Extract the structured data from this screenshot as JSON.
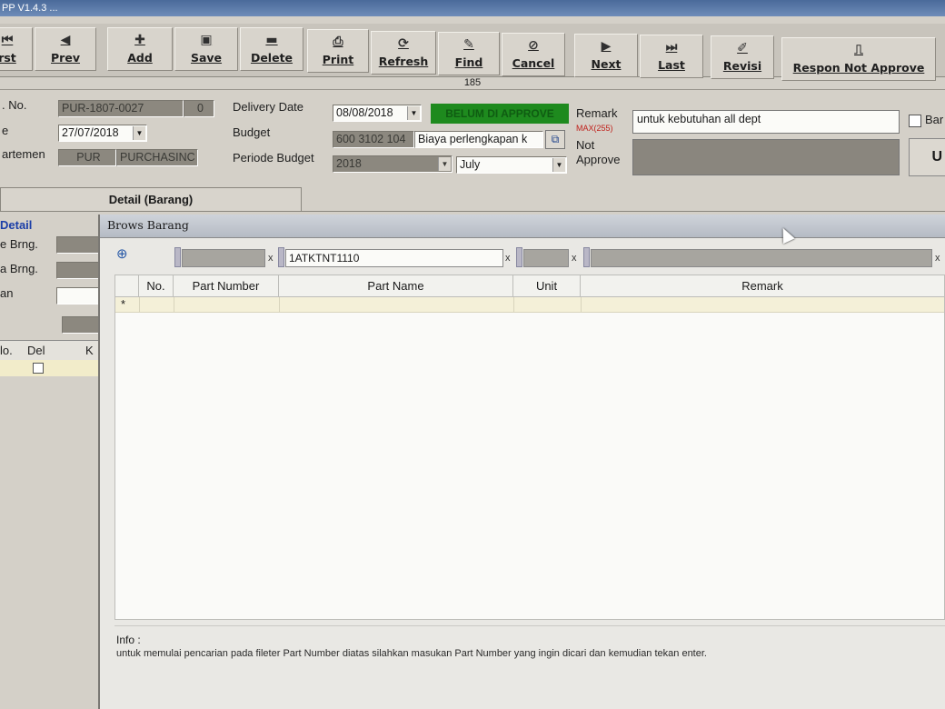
{
  "window": {
    "title": "PP V1.4.3 ..."
  },
  "toolbar": {
    "buttons": [
      {
        "label": "rst",
        "icon": "first-icon"
      },
      {
        "label": "Prev",
        "icon": "prev-icon"
      },
      {
        "label": "Add",
        "icon": "add-icon"
      },
      {
        "label": "Save",
        "icon": "save-icon"
      },
      {
        "label": "Delete",
        "icon": "delete-icon"
      },
      {
        "label": "Print",
        "icon": "print-icon"
      },
      {
        "label": "Refresh",
        "icon": "refresh-icon"
      },
      {
        "label": "Find",
        "icon": "find-icon"
      },
      {
        "label": "Cancel",
        "icon": "cancel-icon"
      },
      {
        "label": "Next",
        "icon": "next-icon"
      },
      {
        "label": "Last",
        "icon": "last-icon"
      },
      {
        "label": "Revisi",
        "icon": "revisi-icon"
      },
      {
        "label": "Respon Not Approve",
        "icon": "respon-icon"
      }
    ]
  },
  "record": {
    "counter": "185"
  },
  "form": {
    "no_label": ". No.",
    "no_value": "PUR-1807-0027",
    "no_rev": "0",
    "date_label": "e",
    "date_value": "27/07/2018",
    "dept_label": "artemen",
    "dept_code": "PUR",
    "dept_name": "PURCHASINC",
    "delivery_label": "Delivery Date",
    "delivery_value": "08/08/2018",
    "budget_label": "Budget",
    "budget_code": "600 3102 104",
    "budget_name": "Biaya perlengkapan k",
    "periode_label": "Periode Budget",
    "periode_year": "2018",
    "periode_month": "July",
    "status": "BELUM DI APPROVE",
    "remark_label": "Remark",
    "remark_max": "MAX(255)",
    "remark_value": "untuk kebutuhan all dept",
    "not_approve_label": "Not Approve",
    "bar_label": "Bar",
    "u_label": "U"
  },
  "tabs": {
    "detail": "Detail (Barang)"
  },
  "left_panel": {
    "detail_label": "Detail",
    "kode_label": "e Brng.",
    "nama_label": "a Brng.",
    "satuan_label": "an",
    "col_no": "lo.",
    "col_del": "Del",
    "col_k": "K"
  },
  "popup": {
    "title": "Brows Barang",
    "filter": {
      "part_number": "",
      "part_name": "1ATKTNT1110",
      "unit": "",
      "remark": "",
      "clear": "x"
    },
    "columns": [
      "No.",
      "Part Number",
      "Part Name",
      "Unit",
      "Remark"
    ],
    "new_row_marker": "*",
    "info_title": "Info :",
    "info_text": "untuk memulai pencarian pada fileter Part Number diatas silahkan masukan Part Number yang ingin dicari dan kemudian tekan enter."
  },
  "colors": {
    "status_green": "#1e8a1e",
    "titlebar": "#4a6a9a"
  }
}
